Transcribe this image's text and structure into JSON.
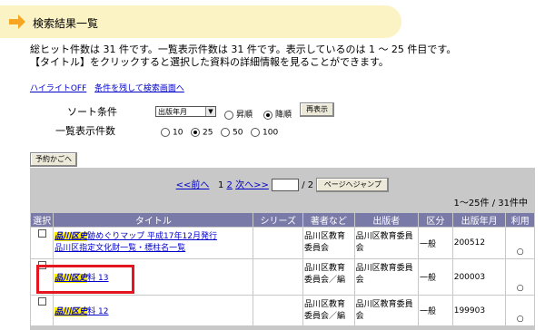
{
  "header": {
    "title": "検索結果一覧"
  },
  "summary": {
    "line1": "総ヒット件数は 31 件です。一覧表示件数は 31 件です。表示しているのは 1 〜 25 件目です。",
    "line2": "【タイトル】をクリックすると選択した資料の詳細情報を見ることができます。"
  },
  "links": {
    "highlight_off": "ハイライトOFF",
    "back_to_search": "条件を残して検索画面へ"
  },
  "sort": {
    "label": "ソート条件",
    "selected": "出版年月",
    "asc": "昇順",
    "desc": "降順",
    "redisplay": "再表示"
  },
  "display_count": {
    "label": "一覧表示件数",
    "options": [
      "10",
      "25",
      "50",
      "100"
    ],
    "selected": "25"
  },
  "reserve_basket": "予約かごへ",
  "pager": {
    "prev": "<<前へ",
    "page1": "1",
    "page2": "2",
    "next": "次へ>>",
    "total_pages": "/ 2",
    "jump": "ページへジャンプ",
    "range": "1〜25件 / 31件中"
  },
  "table": {
    "headers": [
      "選択",
      "タイトル",
      "シリーズ",
      "著者など",
      "出版者",
      "区分",
      "出版年月",
      "利用"
    ],
    "rows": [
      {
        "title_hl": "品川区史",
        "title_rest": "跡めぐりマップ 平成17年12月発行",
        "title_line2": "品川区指定文化財一覧・標柱名一覧",
        "series": "",
        "author": "品川区教育委員会",
        "publisher": "品川区教育委員会",
        "kubun": "一般",
        "date": "200512",
        "riyou": "○"
      },
      {
        "title_hl": "品川区史",
        "title_rest": "料 13",
        "title_line2": "",
        "series": "",
        "author": "品川区教育委員会／編",
        "publisher": "品川区教育委員会",
        "kubun": "一般",
        "date": "200003",
        "riyou": "○"
      },
      {
        "title_hl": "品川区史",
        "title_rest": "料 12",
        "title_line2": "",
        "series": "",
        "author": "品川区教育委員会／編",
        "publisher": "品川区教育委員会",
        "kubun": "一般",
        "date": "199903",
        "riyou": "○"
      }
    ]
  },
  "colors": {
    "banner": "#fbf3c4",
    "arrow": "#f5a623",
    "table_header": "#7a7aa8",
    "panel": "#c8c8c8",
    "highlight": "#fff000",
    "callout": "#e4151f"
  }
}
